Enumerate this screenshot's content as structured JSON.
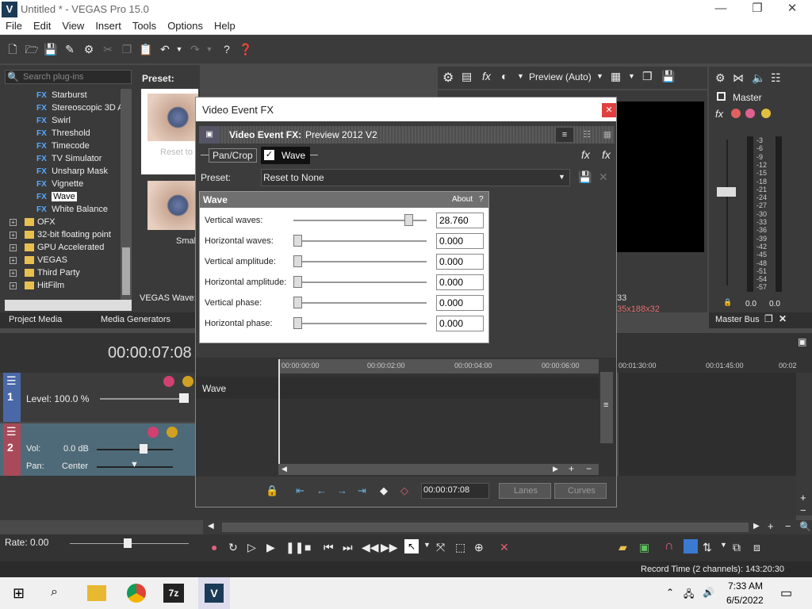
{
  "window": {
    "title": "Untitled * - VEGAS Pro 15.0",
    "logo": "V",
    "minimize": "—",
    "maximize": "❐",
    "close": "✕"
  },
  "menu": [
    "File",
    "Edit",
    "View",
    "Insert",
    "Tools",
    "Options",
    "Help"
  ],
  "plugins": {
    "search_placeholder": "Search plug-ins",
    "fx_badge": "FX",
    "items": [
      "Starburst",
      "Stereoscopic 3D A",
      "Swirl",
      "Threshold",
      "Timecode",
      "TV Simulator",
      "Unsharp Mask",
      "Vignette",
      "Wave",
      "White Balance"
    ],
    "folders": [
      "OFX",
      "32-bit floating point",
      "GPU Accelerated",
      "VEGAS",
      "Third Party",
      "HitFilm"
    ],
    "selected": "Wave"
  },
  "preset_panel": {
    "label": "Preset:",
    "thumb2_label": "Smal",
    "thumb1_label": "Reset to",
    "footer": "VEGAS Wave:"
  },
  "tabs": {
    "project_media": "Project Media",
    "media_generators": "Media Generators"
  },
  "preview": {
    "mode": "Preview (Auto)",
    "info1": "33",
    "info2": "35x188x32"
  },
  "master": {
    "label": "Master",
    "bus_label": "Master Bus",
    "ticks": [
      "-3",
      "-6",
      "-9",
      "-12",
      "-15",
      "-18",
      "-21",
      "-24",
      "-27",
      "-30",
      "-33",
      "-36",
      "-39",
      "-42",
      "-45",
      "-48",
      "-51",
      "-54",
      "-57"
    ],
    "readout_left": "0.0",
    "readout_right": "0.0"
  },
  "dialog": {
    "title": "Video Event FX",
    "header": "Video Event FX:",
    "header_value": "Preview 2012 V2",
    "chain": [
      "Pan/Crop",
      "Wave"
    ],
    "preset_label": "Preset:",
    "preset_value": "Reset to None",
    "fx_panel_title": "Wave",
    "about": "About",
    "about_q": "?",
    "params": [
      {
        "label": "Vertical waves:",
        "value": "28.760",
        "position": 0.89
      },
      {
        "label": "Horizontal waves:",
        "value": "0.000",
        "position": 0.0
      },
      {
        "label": "Vertical amplitude:",
        "value": "0.000",
        "position": 0.0
      },
      {
        "label": "Horizontal amplitude:",
        "value": "0.000",
        "position": 0.0
      },
      {
        "label": "Vertical phase:",
        "value": "0.000",
        "position": 0.0
      },
      {
        "label": "Horizontal phase:",
        "value": "0.000",
        "position": 0.0
      }
    ],
    "keyframe_track": "Wave",
    "ruler": [
      "00:00:00:00",
      "00:00:02:00",
      "00:00:04:00",
      "00:00:06:00"
    ],
    "time": "00:00:07:08",
    "lanes": "Lanes",
    "curves": "Curves"
  },
  "timeline": {
    "time": "00:00:07:08",
    "track1_level": "Level: 100.0 %",
    "track1_num": "1",
    "track2_num": "2",
    "vol_label": "Vol:",
    "vol_value": "0.0 dB",
    "pan_label": "Pan:",
    "pan_value": "Center",
    "ruler": [
      "00:01:30:00",
      "00:01:45:00",
      "00:02"
    ],
    "rate": "Rate: 0.00",
    "record_time": "Record Time (2 channels): 143:20:30"
  },
  "taskbar": {
    "time": "7:33 AM",
    "date": "6/5/2022",
    "app_7z": "7z",
    "app_vegas": "V"
  }
}
